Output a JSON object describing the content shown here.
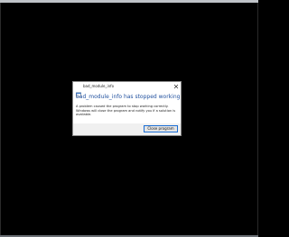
{
  "dialog": {
    "title": "bad_module_info",
    "heading": "bad_module_info has stopped working",
    "message": "A problem caused the program to stop working correctly. Windows will close the program and notify you if a solution is available.",
    "close_button_label": "Close program",
    "app_icon": "application-icon",
    "close_icon": "close-icon"
  },
  "colors": {
    "desktop": "#000000",
    "heading": "#1f4f9e",
    "button_border": "#1c6ed4"
  }
}
